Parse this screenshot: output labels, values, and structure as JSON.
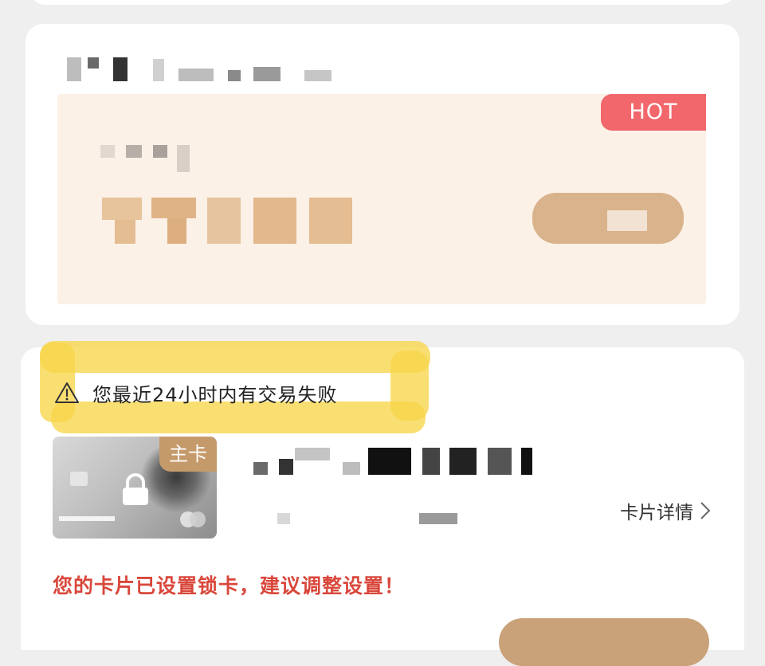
{
  "promo": {
    "hot_badge": "HOT"
  },
  "alert": {
    "icon": "warning-triangle-icon",
    "text": "您最近24小时内有交易失败"
  },
  "card": {
    "tag": "主卡",
    "detail_link": "卡片详情",
    "detail_icon": "chevron-right-icon",
    "lock_notice": "您的卡片已设置锁卡，建议调整设置！"
  },
  "colors": {
    "hot_badge": "#f2676c",
    "promo_bg": "#fcf1e7",
    "card_tag": "#c59a6a",
    "lock_notice": "#d9473b",
    "highlight": "#f7d64a"
  }
}
